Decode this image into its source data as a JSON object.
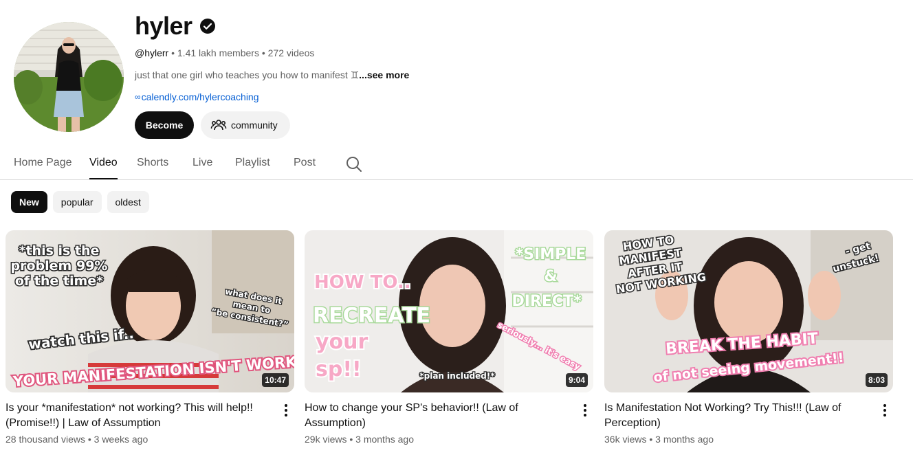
{
  "channel": {
    "name": "hyler",
    "handle": "@hylerr",
    "stats": " • 1.41 lakh members • 272 videos",
    "description": "just that one girl who teaches you how to manifest ♊",
    "description_more": "...see more",
    "link": "calendly.com/hylercoaching",
    "link_icon": "∞",
    "become_label": "Become",
    "community_label": "community"
  },
  "tabs": [
    {
      "label": "Home Page"
    },
    {
      "label": "Video"
    },
    {
      "label": "Shorts"
    },
    {
      "label": "Live"
    },
    {
      "label": "Playlist"
    },
    {
      "label": "Post"
    }
  ],
  "chips": [
    {
      "label": "New"
    },
    {
      "label": "popular"
    },
    {
      "label": "oldest"
    }
  ],
  "videos": [
    {
      "title": "Is your *manifestation* not working? This will help!! (Promise!!) | Law of Assumption",
      "meta": "28 thousand views • 3 weeks ago",
      "duration": "10:47",
      "overlay": {
        "t1": "*this is the",
        "t2": "problem 99%",
        "t3": "of the time*",
        "t4": "what does it",
        "t5": "mean to",
        "t6": "“be consistent?”",
        "t7": "watch this if..",
        "t8": "YOUR MANIFESTATION ISN'T WORKIN"
      }
    },
    {
      "title": "How to change your SP's behavior!! (Law of Assumption)",
      "meta": "29k views • 3 months ago",
      "duration": "9:04",
      "overlay": {
        "t1": "HOW TO..",
        "t2": "RECREATE",
        "t3": "your",
        "t4": "sp!!",
        "t5": "*SIMPLE",
        "t6": "&",
        "t7": "DIRECT*",
        "t8": "seriously... it's easy",
        "t9": "*plan included!*"
      }
    },
    {
      "title": "Is Manifestation Not Working? Try This!!! (Law of Perception)",
      "meta": "36k views • 3 months ago",
      "duration": "8:03",
      "overlay": {
        "t1": "HOW TO",
        "t2": "MANIFEST",
        "t3": "AFTER IT",
        "t4": "NOT WORKING",
        "t5": "- get",
        "t6": "unstuck!",
        "t7": "BREAK THE HABIT",
        "t8": "of not seeing movement!!"
      }
    }
  ]
}
